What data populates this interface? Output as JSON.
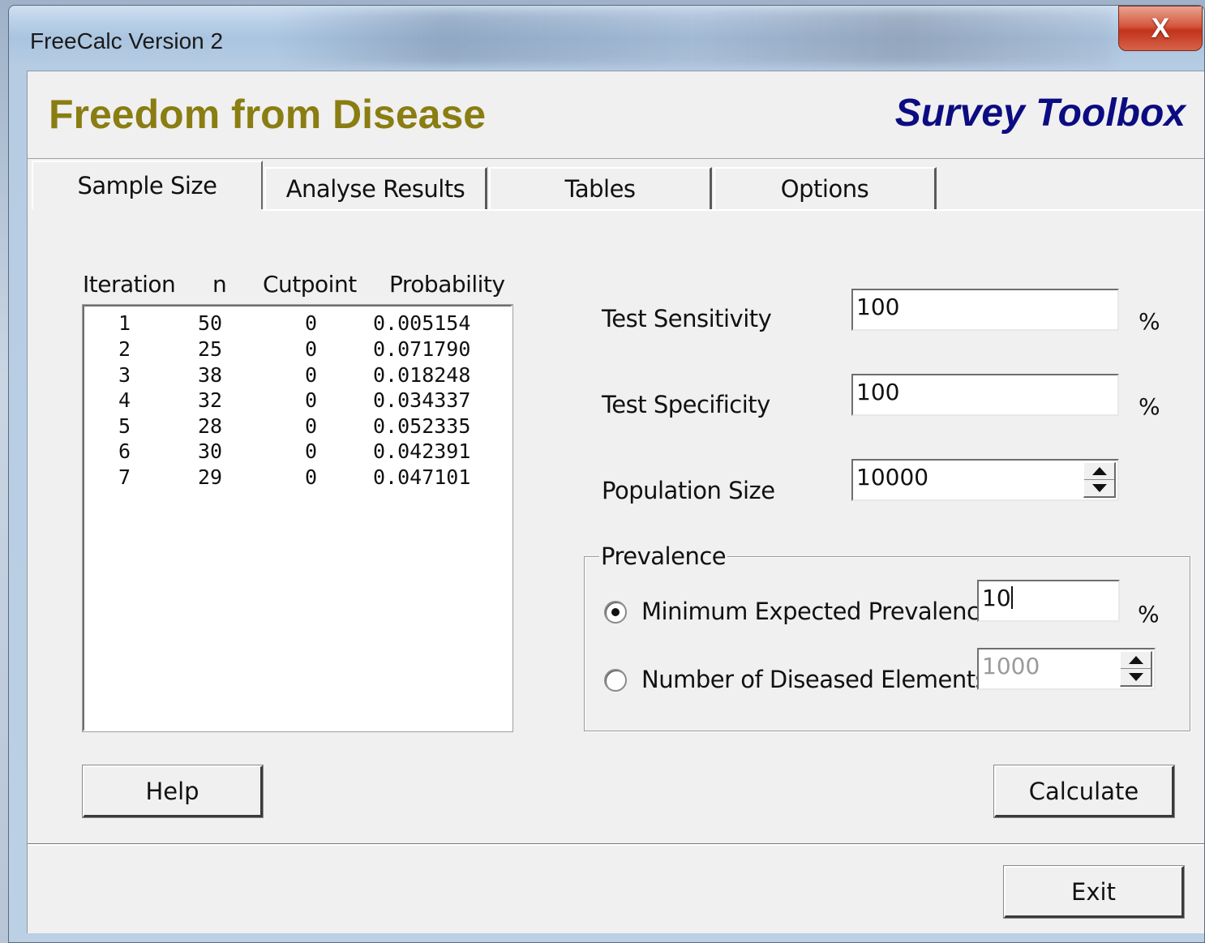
{
  "window": {
    "title": "FreeCalc Version 2",
    "close_label": "X"
  },
  "header": {
    "app_title": "Freedom from Disease",
    "brand": "Survey Toolbox",
    "app_title_color": "#8a7d12",
    "brand_color": "#0c0c82"
  },
  "tabs": [
    {
      "label": "Sample Size",
      "active": true
    },
    {
      "label": "Analyse Results",
      "active": false
    },
    {
      "label": "Tables",
      "active": false
    },
    {
      "label": "Options",
      "active": false
    }
  ],
  "iterations": {
    "columns": [
      "Iteration",
      "n",
      "Cutpoint",
      "Probability"
    ],
    "rows": [
      [
        "1",
        "50",
        "0",
        "0.005154"
      ],
      [
        "2",
        "25",
        "0",
        "0.071790"
      ],
      [
        "3",
        "38",
        "0",
        "0.018248"
      ],
      [
        "4",
        "32",
        "0",
        "0.034337"
      ],
      [
        "5",
        "28",
        "0",
        "0.052335"
      ],
      [
        "6",
        "30",
        "0",
        "0.042391"
      ],
      [
        "7",
        "29",
        "0",
        "0.047101"
      ]
    ]
  },
  "inputs": {
    "sensitivity": {
      "label": "Test Sensitivity",
      "value": "100",
      "unit": "%"
    },
    "specificity": {
      "label": "Test Specificity",
      "value": "100",
      "unit": "%"
    },
    "population": {
      "label": "Population Size",
      "value": "10000"
    }
  },
  "prevalence": {
    "legend": "Prevalence",
    "min_expected": {
      "label": "Minimum Expected Prevalence",
      "value": "10",
      "unit": "%",
      "selected": true
    },
    "diseased": {
      "label": "Number of Diseased Elements",
      "value": "1000",
      "selected": false
    }
  },
  "buttons": {
    "help": "Help",
    "calculate": "Calculate",
    "exit": "Exit"
  }
}
